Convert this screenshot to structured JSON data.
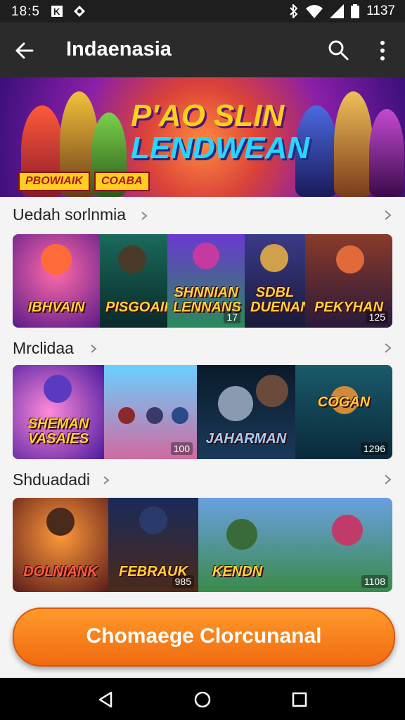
{
  "status_bar": {
    "time": "18:5",
    "battery_text": "1137",
    "left_icons": [
      "notification-k-icon",
      "notification-diamond-icon"
    ],
    "right_icons": [
      "bluetooth-icon",
      "wifi-icon",
      "signal-icon",
      "battery-icon"
    ]
  },
  "app_bar": {
    "title": "Indaenasia",
    "icons": [
      "back-arrow-icon",
      "search-icon",
      "more-vert-icon"
    ]
  },
  "banner": {
    "title_line1": "P'AO SLIN",
    "title_line2": "LENDWEAN",
    "tag1": "PBOWIAIK",
    "tag2": "COABA"
  },
  "sections": [
    {
      "heading": "Uedah sorlnmia",
      "cards": [
        {
          "label": "IBHVAIN",
          "number": ""
        },
        {
          "label": "PISGOAIK",
          "number": ""
        },
        {
          "label": "SHNNIAN LENNANS",
          "number": "17"
        },
        {
          "label": "SDBL DUENAN",
          "number": ""
        },
        {
          "label": "PEKYHAN",
          "number": "125"
        }
      ]
    },
    {
      "heading": "Mrclidaa",
      "cards": [
        {
          "label": "SHEMAN VASAIES",
          "number": "100"
        },
        {
          "label": "JAHARMAN",
          "number": ""
        },
        {
          "label": "COGAN",
          "number": "1296"
        }
      ]
    },
    {
      "heading": "Shduadadi",
      "cards": [
        {
          "label": "DOLNIANK",
          "number": ""
        },
        {
          "label": "FEBRAUK",
          "number": "985"
        },
        {
          "label": "KENDN",
          "number": "1108"
        }
      ]
    }
  ],
  "cta_button": {
    "label": "Chomaege Clorcunanal"
  },
  "nav_bar": {
    "icons": [
      "nav-back-icon",
      "nav-home-icon",
      "nav-recents-icon"
    ]
  },
  "colors": {
    "cta_orange": "#f47a16",
    "app_bar": "#2b2b2b",
    "status_bar": "#1e1e1e",
    "background": "#f4f4f4"
  }
}
